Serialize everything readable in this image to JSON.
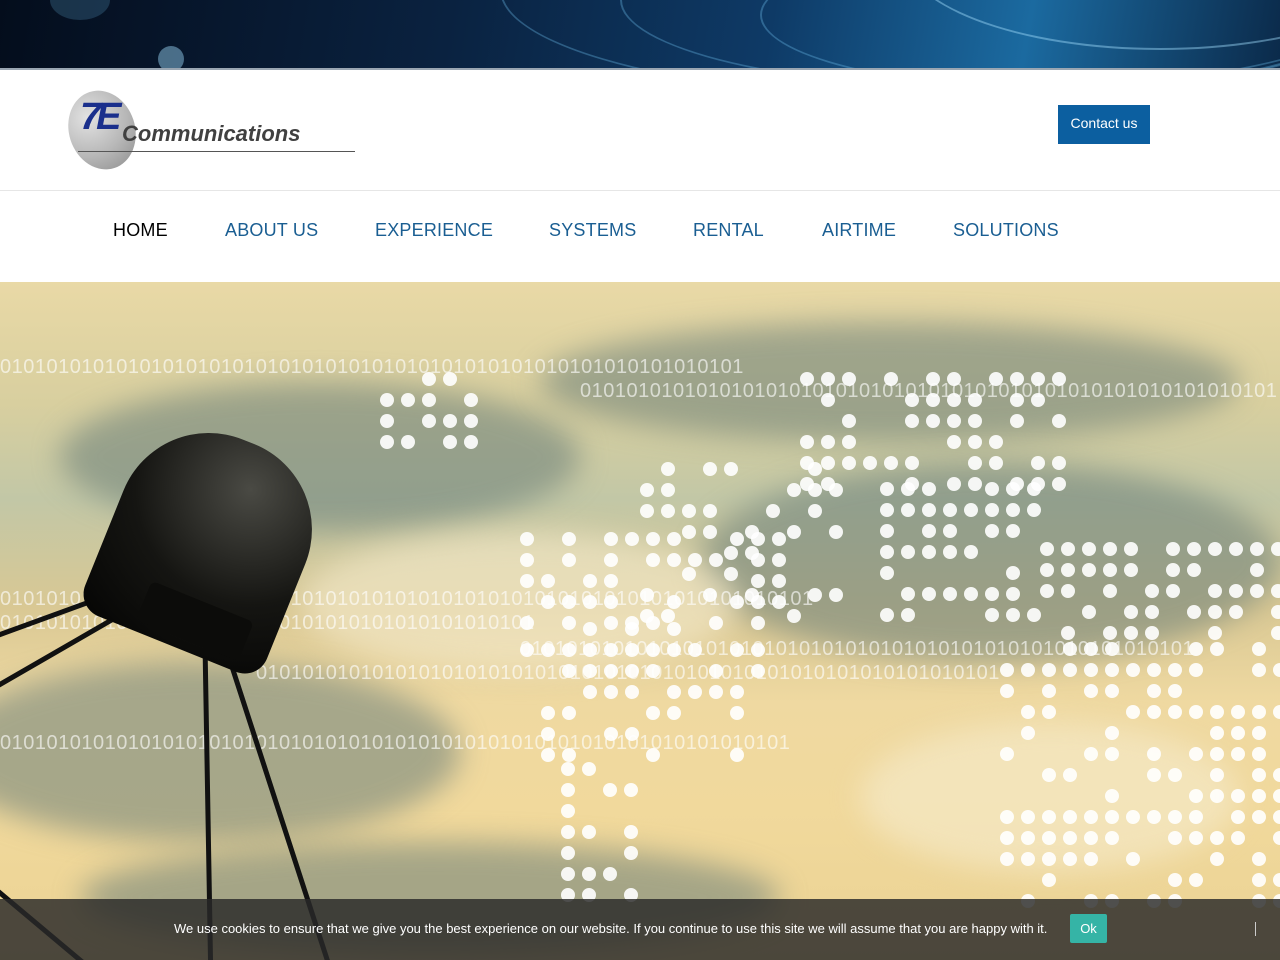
{
  "brand": {
    "logo_mark": "7E",
    "logo_text": "Communications"
  },
  "header": {
    "contact_label": "Contact us"
  },
  "nav": {
    "items": [
      {
        "label": "HOME",
        "active": true
      },
      {
        "label": "ABOUT US",
        "active": false
      },
      {
        "label": "EXPERIENCE",
        "active": false
      },
      {
        "label": "SYSTEMS",
        "active": false
      },
      {
        "label": "RENTAL",
        "active": false
      },
      {
        "label": "AIRTIME",
        "active": false
      },
      {
        "label": "SOLUTIONS",
        "active": false
      }
    ]
  },
  "hero": {
    "image": "satellite-antenna-world-map-dots"
  },
  "cookie": {
    "message": "We use cookies to ensure that we give you the best experience on our website. If you continue to use this site we will assume that you are happy with it.",
    "ok_label": "Ok"
  },
  "colors": {
    "nav_link": "#1a5e92",
    "nav_active": "#000000",
    "primary_button": "#0c5fa0",
    "cookie_button": "#35b4a6"
  }
}
